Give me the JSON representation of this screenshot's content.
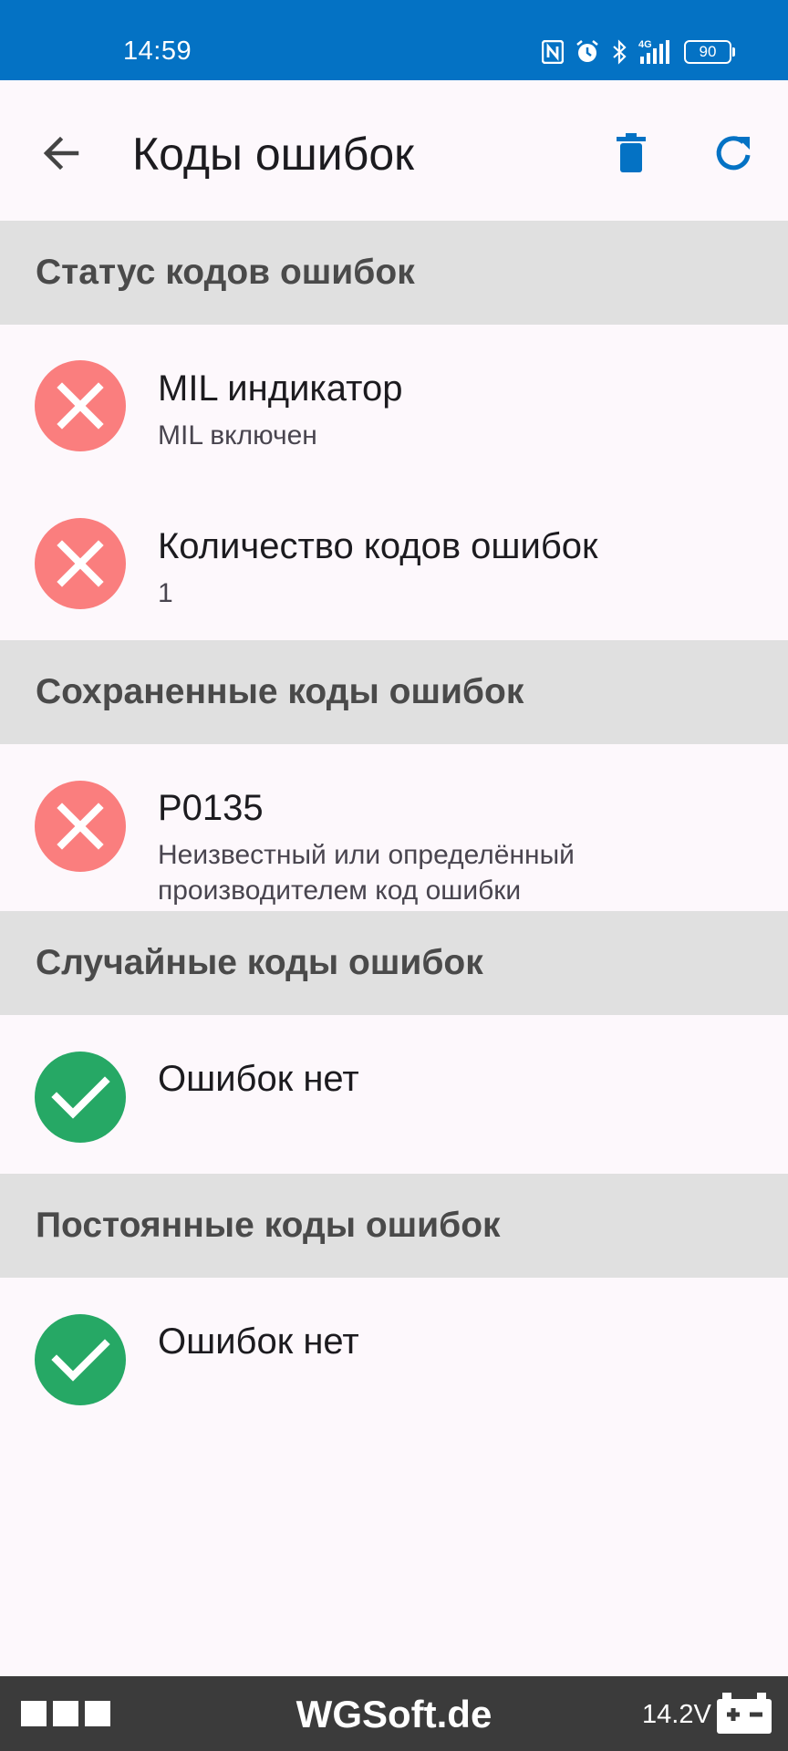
{
  "status_bar": {
    "time": "14:59",
    "signal": "4G",
    "battery": "90"
  },
  "app_bar": {
    "title": "Коды ошибок"
  },
  "sections": {
    "status": {
      "header": "Статус кодов ошибок",
      "items": [
        {
          "title": "MIL индикатор",
          "subtitle": "MIL включен",
          "state": "error"
        },
        {
          "title": "Количество кодов ошибок",
          "subtitle": "1",
          "state": "error"
        }
      ]
    },
    "stored": {
      "header": "Сохраненные коды ошибок",
      "items": [
        {
          "title": "P0135",
          "subtitle_line1": "Неизвестный или определённый",
          "subtitle_line2": "производителем код ошибки",
          "state": "error"
        }
      ]
    },
    "pending": {
      "header": "Случайные коды ошибок",
      "items": [
        {
          "title": "Ошибок нет",
          "state": "ok"
        }
      ]
    },
    "permanent": {
      "header": "Постоянные коды ошибок",
      "items": [
        {
          "title": "Ошибок нет",
          "state": "ok"
        }
      ]
    }
  },
  "bottom_bar": {
    "brand": "WGSoft.de",
    "voltage": "14.2V"
  },
  "colors": {
    "status_bar": "#0472c4",
    "accent": "#0472c4",
    "error": "#fa7e7e",
    "ok": "#26a865",
    "section_bg": "#e0e0e0",
    "bottom_bar": "#3b3b3b"
  },
  "icons": {
    "back": "arrow-left-icon",
    "delete": "trash-icon",
    "refresh": "refresh-icon",
    "error": "close-icon",
    "ok": "check-icon",
    "car_battery": "car-battery-icon"
  }
}
